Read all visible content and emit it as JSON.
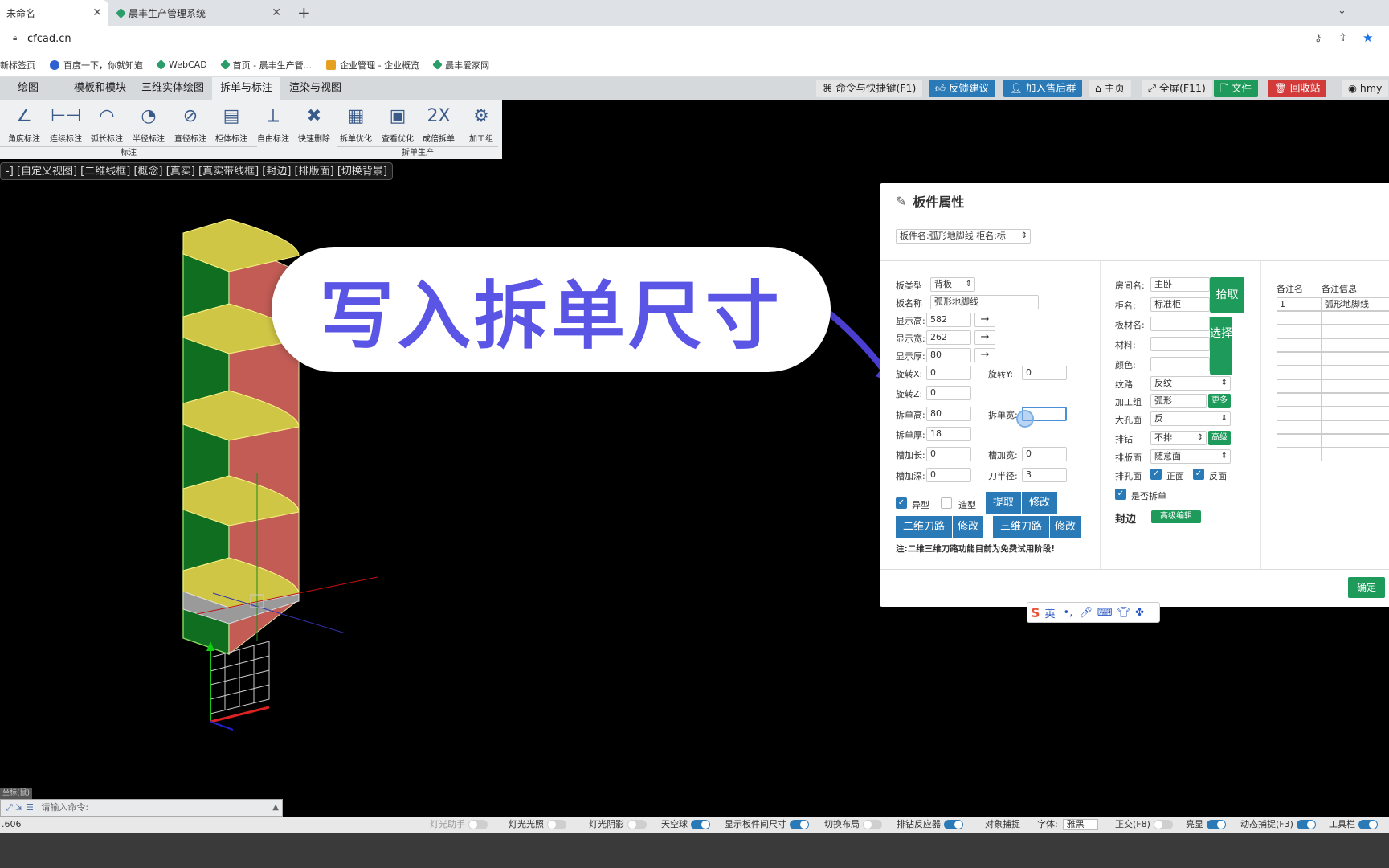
{
  "browser": {
    "tabs": [
      {
        "title": "未命名",
        "active": true
      },
      {
        "title": "晨丰生产管理系统",
        "active": false
      }
    ],
    "new_tab": "+",
    "url": "cfcad.cn",
    "bookmarks": [
      "新标签页",
      "百度一下，你就知道",
      "WebCAD",
      "首页 - 晨丰生产管...",
      "企业管理 - 企业概览",
      "晨丰爱家网"
    ]
  },
  "app": {
    "menu_tabs": [
      "绘图",
      "模板和模块",
      "三维实体绘图",
      "拆单与标注",
      "渲染与视图"
    ],
    "active_menu": "拆单与标注",
    "top_buttons": [
      {
        "label": "命令与快捷键(F1)",
        "color": "#e6e6e6",
        "text": "#222"
      },
      {
        "label": "反馈建议",
        "color": "#2a7ab8",
        "text": "#fff"
      },
      {
        "label": "加入售后群",
        "color": "#2a7ab8",
        "text": "#fff"
      },
      {
        "label": "主页",
        "color": "#e6e6e6",
        "text": "#222"
      },
      {
        "label": "全屏(F11)",
        "color": "#e6e6e6",
        "text": "#222"
      },
      {
        "label": "文件",
        "color": "#1e9a5a",
        "text": "#fff"
      },
      {
        "label": "回收站",
        "color": "#d33a3a",
        "text": "#fff"
      },
      {
        "label": "hmy",
        "color": "#e6e6e6",
        "text": "#222"
      }
    ],
    "ribbon_tools": [
      {
        "label": "角度标注",
        "icon": "∠"
      },
      {
        "label": "连续标注",
        "icon": "⊢⊣"
      },
      {
        "label": "弧长标注",
        "icon": "◠"
      },
      {
        "label": "半径标注",
        "icon": "◔"
      },
      {
        "label": "直径标注",
        "icon": "⊘"
      },
      {
        "label": "柜体标注",
        "icon": "▤"
      },
      {
        "label": "自由标注",
        "icon": "⟂"
      },
      {
        "label": "快速删除",
        "icon": "✖"
      },
      {
        "label": "拆单优化",
        "icon": "▦"
      },
      {
        "label": "查看优化",
        "icon": "▣"
      },
      {
        "label": "成倍拆单",
        "icon": "2X"
      },
      {
        "label": "加工组",
        "icon": "⚙"
      }
    ],
    "ribbon_groups": [
      "标注",
      "拆单生产"
    ],
    "view_links": "-] [自定义视图] [二维线框] [概念] [真实] [真实带线框] [封边] [排版面] [切换背景]"
  },
  "overlay": {
    "text": "写入拆单尺寸"
  },
  "dialog": {
    "title": "板件属性",
    "board_select": "板件名:弧形地脚线 柜名:标",
    "fields": {
      "board_type_label": "板类型",
      "board_type": "背板",
      "board_name_label": "板名称",
      "board_name": "弧形地脚线",
      "show_h_label": "显示高:",
      "show_h": "582",
      "show_w_label": "显示宽:",
      "show_w": "262",
      "show_t_label": "显示厚:",
      "show_t": "80",
      "rot_x_label": "旋转X:",
      "rot_x": "0",
      "rot_y_label": "旋转Y:",
      "rot_y": "0",
      "rot_z_label": "旋转Z:",
      "rot_z": "0",
      "split_h_label": "拆单高:",
      "split_h": "80",
      "split_w_label": "拆单宽:",
      "split_w": "",
      "split_t_label": "拆单厚:",
      "split_t": "18",
      "slot_len_label": "槽加长:",
      "slot_len": "0",
      "slot_wid_label": "槽加宽:",
      "slot_wid": "0",
      "slot_dep_label": "槽加深:",
      "slot_dep": "0",
      "blade_r_label": "刀半径:",
      "blade_r": "3",
      "shaped_label": "异型",
      "modeling_label": "造型",
      "extract": "提取",
      "modify": "修改",
      "path2d": "二维刀路",
      "path3d": "三维刀路",
      "note": "注:二维三维刀路功能目前为免费试用阶段!"
    },
    "middle": {
      "room_label": "房间名:",
      "room": "主卧",
      "cab_label": "柜名:",
      "cab": "标准柜",
      "mat_name_label": "板材名:",
      "mat_label": "材料:",
      "color_label": "颜色:",
      "pick": "拾取",
      "choose": "选择",
      "grain_label": "纹路",
      "grain": "反纹",
      "process_label": "加工组",
      "process": "弧形",
      "more": "更多",
      "hole_label": "大孔面",
      "hole": "反",
      "drill_label": "排钻",
      "drill": "不排",
      "advanced": "高级",
      "layout_label": "排版面",
      "layout": "随意面",
      "hole_face_label": "排孔面",
      "front": "正面",
      "back": "反面",
      "split_label": "是否拆单",
      "edge_label": "封边",
      "edge_btn": "高级编辑"
    },
    "right": {
      "col1": "备注名",
      "col2": "备注信息",
      "rows": [
        [
          "1",
          "弧形地脚线"
        ],
        [
          "",
          ""
        ],
        [
          "",
          ""
        ],
        [
          "",
          ""
        ],
        [
          "",
          ""
        ],
        [
          "",
          ""
        ],
        [
          "",
          ""
        ],
        [
          "",
          ""
        ],
        [
          "",
          ""
        ],
        [
          "",
          ""
        ],
        [
          "",
          ""
        ],
        [
          "",
          ""
        ]
      ]
    },
    "ok": "确定"
  },
  "ime": {
    "label": "英"
  },
  "cmd": {
    "prompt": "请输入命令:",
    "coord": ".606",
    "tag": "坐标(鼠)"
  },
  "status": [
    {
      "label": "灯光助手",
      "on": false,
      "dim": true
    },
    {
      "label": "灯光光照",
      "on": false
    },
    {
      "label": "灯光阴影",
      "on": false
    },
    {
      "label": "天空球",
      "on": true
    },
    {
      "label": "显示板件间尺寸",
      "on": true
    },
    {
      "label": "切换布局",
      "on": false
    },
    {
      "label": "排钻反应器",
      "on": true
    },
    {
      "label": "对象捕捉",
      "on": null
    },
    {
      "label": "字体:",
      "on": null,
      "select": "雅黑"
    },
    {
      "label": "正交(F8)",
      "on": false
    },
    {
      "label": "亮显",
      "on": true
    },
    {
      "label": "动态捕捉(F3)",
      "on": true
    },
    {
      "label": "工具栏",
      "on": true
    }
  ]
}
